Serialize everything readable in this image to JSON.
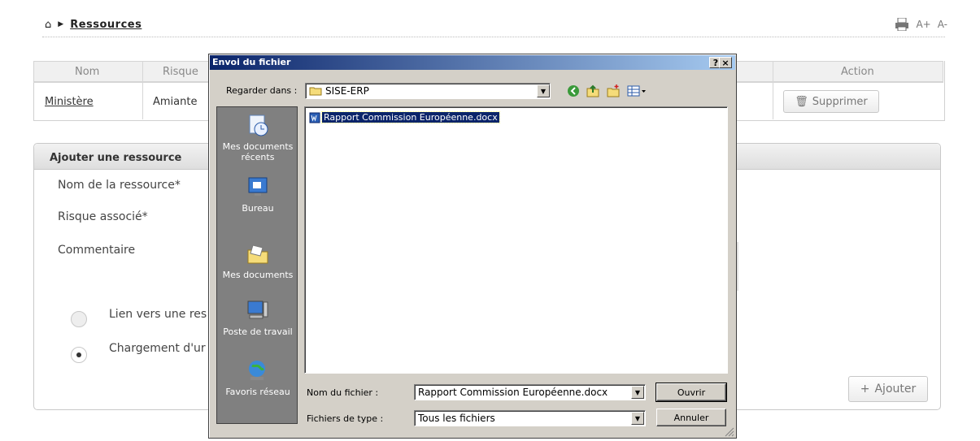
{
  "breadcrumb": {
    "label": "Ressources"
  },
  "tools": {
    "font_plus": "A+",
    "font_minus": "A-"
  },
  "table": {
    "headers": [
      "Nom",
      "Risque",
      "Action"
    ],
    "row": {
      "name": "Ministère",
      "risk": "Amiante",
      "delete_label": "Supprimer"
    }
  },
  "form": {
    "title": "Ajouter une ressource",
    "name_label": "Nom de la ressource*",
    "risk_label": "Risque associé*",
    "comment_label": "Commentaire",
    "option_link": "Lien vers une res",
    "option_upload": "Chargement d'ur",
    "add_label": "Ajouter"
  },
  "dialog": {
    "title": "Envoi du fichier",
    "help": "?",
    "close": "×",
    "look_in_label": "Regarder dans :",
    "look_in_value": "SISE-ERP",
    "places": [
      "Mes documents récents",
      "Bureau",
      "Mes documents",
      "Poste de travail",
      "Favoris réseau"
    ],
    "files": [
      "Rapport Commission Européenne.docx"
    ],
    "filename_label": "Nom du fichier :",
    "filename_value": "Rapport Commission Européenne.docx",
    "filetype_label": "Fichiers de type :",
    "filetype_value": "Tous les fichiers",
    "open_label": "Ouvrir",
    "cancel_label": "Annuler"
  },
  "colors": {
    "title_bar_start": "#0a246a",
    "title_bar_end": "#a6caf0",
    "selection": "#0a246a"
  }
}
